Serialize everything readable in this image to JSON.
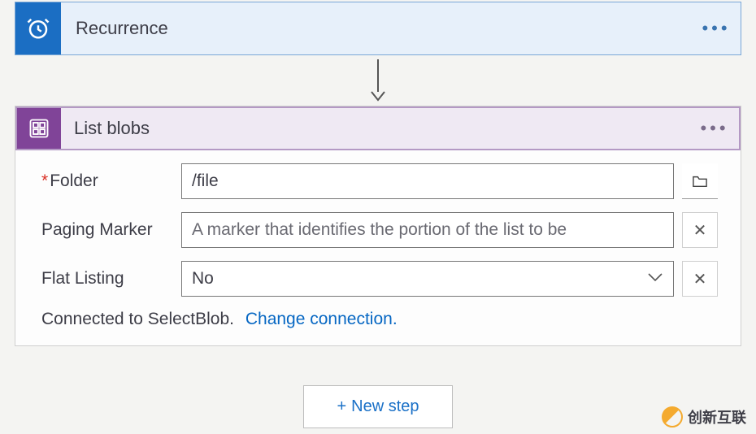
{
  "trigger": {
    "title": "Recurrence",
    "icon": "clock-alarm-icon"
  },
  "action": {
    "title": "List blobs",
    "icon": "blob-storage-icon",
    "fields": {
      "folder": {
        "label": "Folder",
        "required": true,
        "value": "/file"
      },
      "paging_marker": {
        "label": "Paging Marker",
        "placeholder": "A marker that identifies the portion of the list to be",
        "value": ""
      },
      "flat_listing": {
        "label": "Flat Listing",
        "value": "No"
      }
    },
    "connection_text": "Connected to SelectBlob.",
    "change_connection_label": "Change connection."
  },
  "new_step_label": "New step",
  "watermark": "创新互联"
}
